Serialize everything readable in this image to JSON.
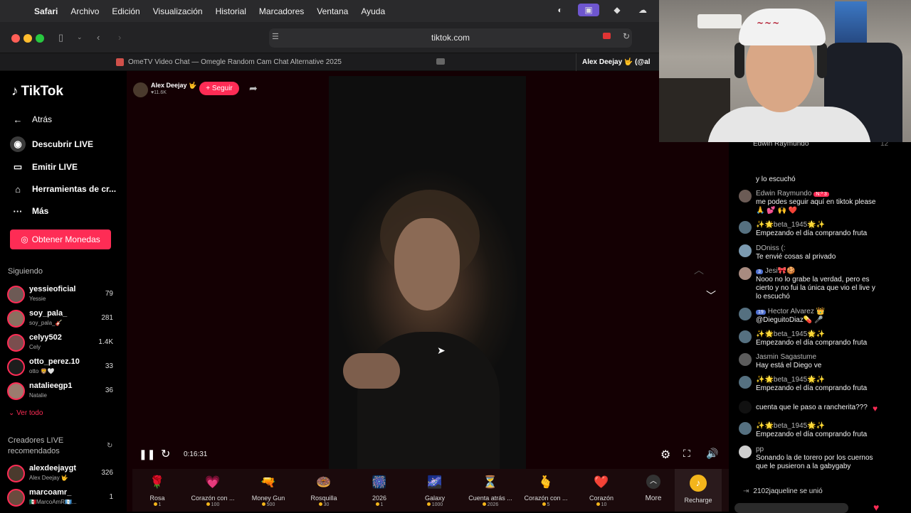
{
  "menubar": {
    "app": "Safari",
    "items": [
      "Archivo",
      "Edición",
      "Visualización",
      "Historial",
      "Marcadores",
      "Ventana",
      "Ayuda"
    ]
  },
  "toolbar": {
    "url": "tiktok.com"
  },
  "tabs": {
    "tab1": "OmeTV Video Chat — Omegle Random Cam Chat Alternative 2025",
    "tab2": "Alex Deejay 🤟 (@al"
  },
  "sidebar": {
    "logo": "TikTok",
    "back": "Atrás",
    "nav": [
      "Descubrir LIVE",
      "Emitir LIVE",
      "Herramientas de cr...",
      "Más"
    ],
    "coins_button": "Obtener Monedas",
    "following_title": "Siguiendo",
    "following": [
      {
        "name": "yessieoficial",
        "sub": "Yessie",
        "count": "79"
      },
      {
        "name": "soy_pala_",
        "sub": "soy_pala_🎸",
        "count": "281"
      },
      {
        "name": "celyy502",
        "sub": "Cely",
        "count": "1.4K"
      },
      {
        "name": "otto_perez.10",
        "sub": "otto 🦁🤍",
        "count": "33"
      },
      {
        "name": "natalieegp1",
        "sub": "Natalie",
        "count": "36"
      }
    ],
    "see_all": "Ver todo",
    "recommended_title_1": "Creadores LIVE",
    "recommended_title_2": "recomendados",
    "recommended": [
      {
        "name": "alexdeejaygt",
        "sub": "Alex Deejay 🤟",
        "count": "326"
      },
      {
        "name": "marcoamr_",
        "sub": "🇲🇽MarcoAmR🇬🇹...",
        "count": "1"
      }
    ]
  },
  "stream": {
    "host_name": "Alex Deejay 🤟",
    "host_likes": "♥11.6K",
    "follow_button": "+ Seguir",
    "time": "0:16:31"
  },
  "gifts": [
    {
      "name": "Rosa",
      "price": "1",
      "icon": "🌹"
    },
    {
      "name": "Corazón con ...",
      "price": "100",
      "icon": "💗"
    },
    {
      "name": "Money Gun",
      "price": "500",
      "icon": "🔫"
    },
    {
      "name": "Rosquilla",
      "price": "30",
      "icon": "🍩"
    },
    {
      "name": "2026",
      "price": "1",
      "icon": "🎆"
    },
    {
      "name": "Galaxy",
      "price": "1000",
      "icon": "🌌"
    },
    {
      "name": "Cuenta atrás ...",
      "price": "2026",
      "icon": "⏳"
    },
    {
      "name": "Corazón con ...",
      "price": "5",
      "icon": "🫰"
    },
    {
      "name": "Corazón",
      "price": "10",
      "icon": "❤️"
    }
  ],
  "gift_more": "More",
  "recharge": "Recharge",
  "chat": {
    "top_user": "Edwin Raymundo",
    "top_count": "12",
    "partial": "y lo escuchó",
    "messages": [
      {
        "user": "Edwin Raymundo",
        "badge": "N.º 3",
        "text": "me podes seguir aquí en tiktok please 🙏 💕 🙌 ❤️"
      },
      {
        "user": "✨🌟beta_1945🌟✨",
        "text": "Empezando el día comprando fruta"
      },
      {
        "user": "DOniss (:",
        "text": "Te envié cosas al privado"
      },
      {
        "user": "Jesi🎀🍪",
        "badge": "3",
        "text": "Nooo no lo grabe la verdad, pero es cierto y no fui la única que vio el live y lo escuchó"
      },
      {
        "user": "Hector Alvarez 👑",
        "badge": "19",
        "text": "@DieguitoDiaz💊 🎤"
      },
      {
        "user": "✨🌟beta_1945🌟✨",
        "text": "Empezando el día comprando fruta"
      },
      {
        "user": "Jasmin Sagastume",
        "text": "Hay está el Diego ve"
      },
      {
        "user": "✨🌟beta_1945🌟✨",
        "text": "Empezando el día comprando fruta"
      },
      {
        "user": "",
        "text": "cuenta que le paso a rancherita???"
      },
      {
        "user": "✨🌟beta_1945🌟✨",
        "text": "Empezando el día comprando fruta"
      },
      {
        "user": "pp",
        "text": "Sonando la de torero por los cuernos que le pusieron a la gabygaby"
      }
    ],
    "joined": "2102jaqueline  se unió"
  },
  "colors": {
    "accent": "#fe2c55",
    "stage_bg": "#140003"
  }
}
